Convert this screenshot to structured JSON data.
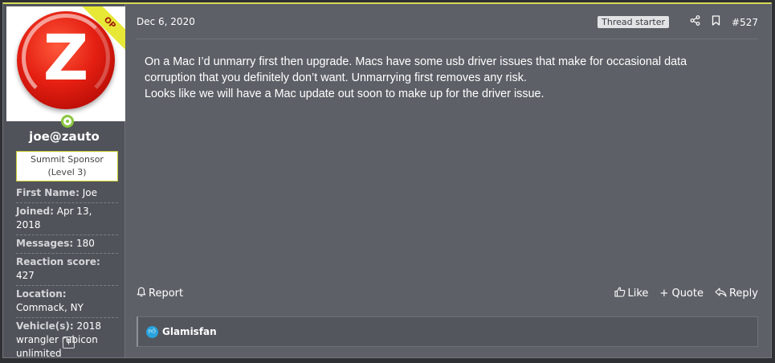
{
  "post": {
    "date": "Dec 6, 2020",
    "starter_badge": "Thread starter",
    "number": "#527",
    "body_lines": [
      "On a Mac I’d unmarry first then upgrade. Macs have some usb driver issues that make for occasional data",
      "corruption that you definitely don’t want. Unmarrying first removes any risk.",
      "Looks like we will have a Mac update out soon to make up for the driver issue."
    ]
  },
  "user": {
    "avatar_letter": "Z",
    "op_badge": "OP",
    "username": "joe@zauto",
    "title_line1": "Summit Sponsor",
    "title_line2": "(Level 3)",
    "stats": [
      {
        "key": "First Name:",
        "value": "Joe"
      },
      {
        "key": "Joined:",
        "value": "Apr 13, 2018"
      },
      {
        "key": "Messages:",
        "value": "180"
      },
      {
        "key": "Reaction score:",
        "value": "427"
      },
      {
        "key": "Location:",
        "value": "Commack, NY"
      },
      {
        "key": "Vehicle(s):",
        "value": "2018 wrangler rubicon unlimited"
      }
    ]
  },
  "actions": {
    "report": "Report",
    "like": "Like",
    "quote": "+ Quote",
    "reply": "Reply"
  },
  "reactions": {
    "users": "Glamisfan"
  },
  "icons": {
    "share": "share-icon",
    "bookmark": "bookmark-icon",
    "bell": "bell-icon",
    "thumb": "thumbs-up-icon",
    "reply": "reply-icon",
    "scroll": "arrow-up-icon"
  },
  "colors": {
    "accent": "#d7da57",
    "panel": "#5d6067",
    "user_panel": "#50535a",
    "like": "#2aa3dc",
    "online": "#8bc73f"
  }
}
